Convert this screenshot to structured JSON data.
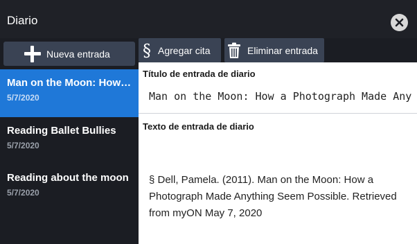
{
  "window": {
    "title": "Diario"
  },
  "sidebar": {
    "new_entry_label": "Nueva entrada",
    "entries": [
      {
        "title": "Man on the Moon: How a Photograph Made Anything Seem Possible",
        "date": "5/7/2020",
        "active": true
      },
      {
        "title": "Reading Ballet Bullies",
        "date": "5/7/2020",
        "active": false
      },
      {
        "title": "Reading about the moon",
        "date": "5/7/2020",
        "active": false
      }
    ]
  },
  "toolbar": {
    "cite_symbol": "§",
    "cite_label": "Agregar cita",
    "delete_label": "Eliminar entrada"
  },
  "editor": {
    "title_label": "Título de entrada de diario",
    "title_value": "Man on the Moon: How a Photograph Made Anything Seem Possible",
    "body_label": "Texto de entrada de diario",
    "body_value": "§ Dell, Pamela. (2011). Man on the Moon: How a Photograph Made Anything Seem Possible. Retrieved from myON May 7, 2020"
  },
  "colors": {
    "background": "#1b1d23",
    "button": "#3a4354",
    "accent": "#1f78d8",
    "editor_bg": "#ffffff"
  },
  "icons": [
    "close-icon",
    "plus-icon",
    "section-sign-icon",
    "trash-icon"
  ]
}
